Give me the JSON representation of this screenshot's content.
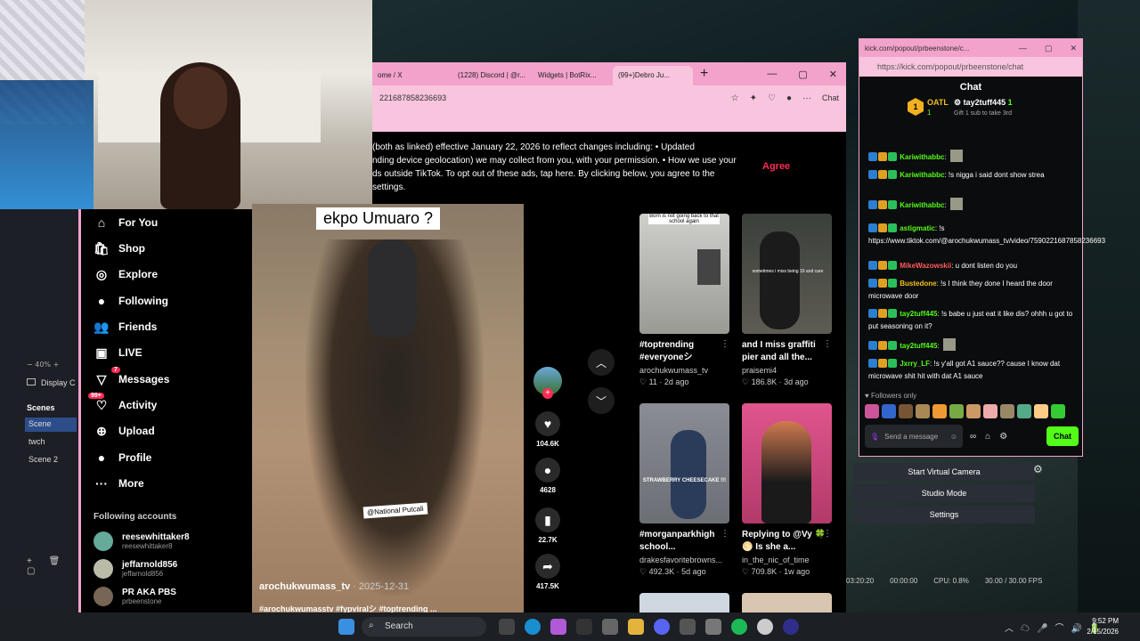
{
  "tiktok": {
    "tabs": [
      "ome / X",
      "(1228) Discord | @r...",
      "Widgets | BotRix...",
      "(99+)Debro Ju..."
    ],
    "url": "221687858236693",
    "chat_button": "Chat",
    "notice": "(both as linked) effective January 22, 2026 to reflect changes including: • Updated\nnding device geolocation) we may collect from you, with your permission. • How we use your\nds outside TikTok. To opt out of these ads, tap here. By clicking below, you agree to the\nsettings.",
    "agree": "Agree",
    "nav": [
      {
        "label": "For You",
        "icon": "home-icon",
        "glyph": "⌂"
      },
      {
        "label": "Shop",
        "icon": "shop-icon",
        "glyph": "🛍"
      },
      {
        "label": "Explore",
        "icon": "compass-icon",
        "glyph": "◎"
      },
      {
        "label": "Following",
        "icon": "following-avatar-icon",
        "glyph": "●"
      },
      {
        "label": "Friends",
        "icon": "friends-icon",
        "glyph": "👥"
      },
      {
        "label": "LIVE",
        "icon": "live-icon",
        "glyph": "▣"
      },
      {
        "label": "Messages",
        "icon": "messages-icon",
        "glyph": "▽"
      },
      {
        "label": "Activity",
        "icon": "activity-icon",
        "glyph": "♡"
      },
      {
        "label": "Upload",
        "icon": "upload-icon",
        "glyph": "⊕"
      },
      {
        "label": "Profile",
        "icon": "profile-avatar-icon",
        "glyph": "●"
      },
      {
        "label": "More",
        "icon": "more-icon",
        "glyph": "···"
      }
    ],
    "messages_badge": "7",
    "activity_badge": "99+",
    "following_header": "Following accounts",
    "accounts": [
      {
        "name": "reesewhittaker8",
        "handle": "reesewhittaker8"
      },
      {
        "name": "jeffarnold856",
        "handle": "jeffarnold856"
      },
      {
        "name": "PR AKA PBS",
        "handle": "prbeenstone"
      }
    ],
    "video": {
      "caption": "ekpo Umuaro ?",
      "tag": "@National Putcali",
      "user": "arochukwumass_tv",
      "date": " · 2025-12-31",
      "hashtags": "#arochukwumasstv #fypviralシ #toptrending ..."
    },
    "actions": [
      {
        "icon": "heart-icon",
        "glyph": "♥",
        "value": "104.6K"
      },
      {
        "icon": "comment-icon",
        "glyph": "●",
        "value": "4628"
      },
      {
        "icon": "bookmark-icon",
        "glyph": "▮",
        "value": "22.7K"
      },
      {
        "icon": "share-icon",
        "glyph": "➦",
        "value": "417.5K"
      }
    ],
    "grid": [
      {
        "title": "#toptrending #everyoneシ",
        "author": "arochukwumass_tv",
        "likes": "11",
        "age": "2d ago",
        "thumb_text": "Born is not going back to that school again"
      },
      {
        "title": "and I miss graffiti pier and all the...",
        "author": "praisemi4",
        "likes": "186.8K",
        "age": "3d ago",
        "thumb_text": "sometimes i miss being 16 and care"
      },
      {
        "title": "#morganparkhigh school...",
        "author": "drakesfavoritebrowns...",
        "likes": "492.3K",
        "age": "5d ago",
        "thumb_text": "STRAWBERRY CHEESECAKE !!!"
      },
      {
        "title": "Replying to @Vy 🍀 🌕 Is she a...",
        "author": "in_the_nic_of_time",
        "likes": "709.8K",
        "age": "1w ago",
        "thumb_text": ""
      }
    ]
  },
  "obs": {
    "zoom": "40%",
    "display": "Display C",
    "scenes_header": "Scenes",
    "scenes": [
      "Scene",
      "twch",
      "Scene 2"
    ],
    "buttons": [
      "Start Virtual Camera",
      "Studio Mode",
      "Settings"
    ],
    "stats": [
      "03:20:20",
      "00:00:00",
      "CPU: 0.8%",
      "30.00 / 30.00 FPS"
    ]
  },
  "kick": {
    "window_title": "kick.com/popout/prbeenstone/c...",
    "url": "https://kick.com/popout/prbeenstone/chat",
    "header": "Chat",
    "leader1": {
      "name": "OATL",
      "count": "1"
    },
    "leader2": {
      "name": "tay2tuff445",
      "count": "1"
    },
    "gift_text": "Gift 1 sub to take 3rd",
    "messages": [
      {
        "user": "Kariwithabbc",
        "text": "",
        "color": "#53fc18"
      },
      {
        "user": "Kariwithabbc",
        "text": " !s nigga i said dont show strea",
        "color": "#53fc18"
      },
      {
        "user": "Kariwithabbc",
        "text": "",
        "color": "#53fc18"
      },
      {
        "user": "astigmatic",
        "text": " !s https://www.tiktok.com/@arochukwumass_tv/video/7590221687858236693",
        "color": "#53fc18"
      },
      {
        "user": "MikeWazowskii",
        "text": " u dont listen do you",
        "color": "#ff5a5a"
      },
      {
        "user": "Bustedone",
        "text": " !s I think they done I heard the door microwave door",
        "color": "#f0c020"
      },
      {
        "user": "tay2tuff445",
        "text": " !s babe u just eat it like dis? ohhh u got to put seasoning on it?",
        "color": "#53fc18"
      },
      {
        "user": "tay2tuff445",
        "text": "",
        "color": "#53fc18"
      },
      {
        "user": "Jxrry_LF",
        "text": " !s y'all got A1 sauce?? cause I know dat microwave shit hit with dat A1 sauce",
        "color": "#53fc18"
      }
    ],
    "followers_only": "Followers only",
    "input_placeholder": "Send a message",
    "send": "Chat"
  },
  "taskbar": {
    "search": "Search",
    "time": "9:52 PM",
    "date": "2/15/2026"
  }
}
